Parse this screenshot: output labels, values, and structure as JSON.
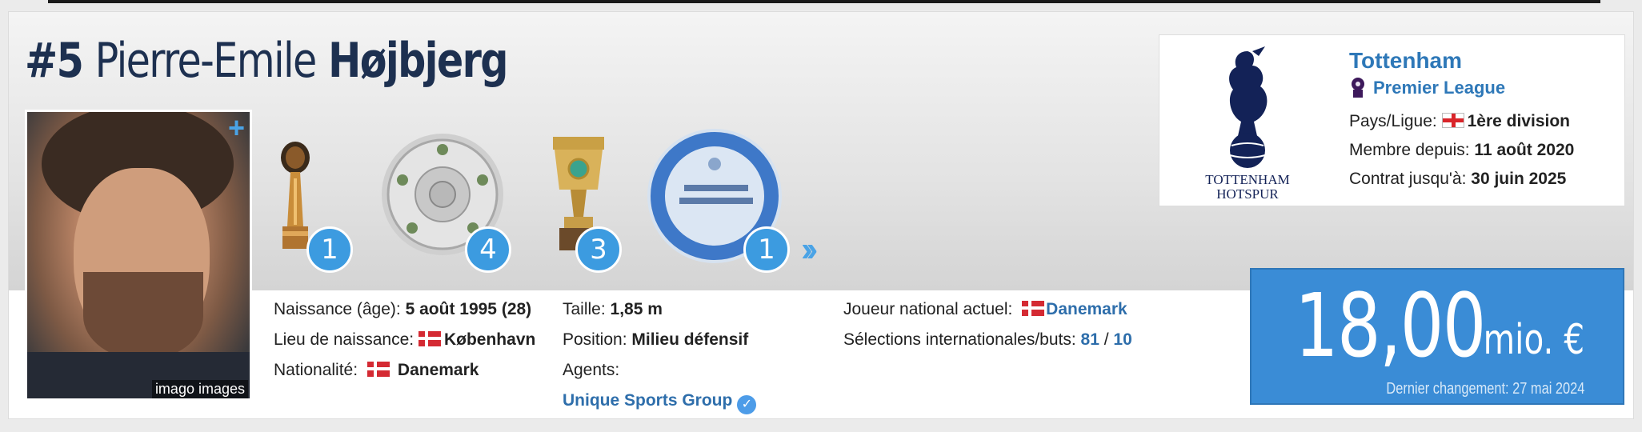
{
  "player": {
    "number": "#5",
    "first_name": "Pierre-Emile",
    "last_name": "Højbjerg",
    "photo_credit": "imago images"
  },
  "trophies": [
    {
      "name": "club-world-cup",
      "count": "1"
    },
    {
      "name": "bundesliga-meisterschale",
      "count": "4"
    },
    {
      "name": "dfb-pokal",
      "count": "3"
    },
    {
      "name": "bayerischer-amateurmeister",
      "count": "1"
    }
  ],
  "club": {
    "name": "Tottenham",
    "league": "Premier League",
    "country_league_label": "Pays/Ligue:",
    "country_league_value": "1ère division",
    "member_since_label": "Membre depuis:",
    "member_since_value": "11 août 2020",
    "contract_label": "Contrat jusqu'à:",
    "contract_value": "30 juin 2025",
    "crest_text_1": "TOTTENHAM",
    "crest_text_2": "HOTSPUR"
  },
  "info": {
    "birth_label": "Naissance (âge):",
    "birth_value": "5 août 1995 (28)",
    "birthplace_label": "Lieu de naissance:",
    "birthplace_value": "København",
    "nationality_label": "Nationalité:",
    "nationality_value": "Danemark",
    "height_label": "Taille:",
    "height_value": "1,85 m",
    "position_label": "Position:",
    "position_value": "Milieu défensif",
    "agents_label": "Agents:",
    "agents_value": "Unique Sports Group",
    "national_label": "Joueur national actuel:",
    "national_value": "Danemark",
    "caps_label": "Sélections internationales/buts:",
    "caps_value": "81",
    "caps_sep": "/",
    "goals_value": "10"
  },
  "market_value": {
    "amount": "18,00",
    "unit": "mio. €",
    "last_change": "Dernier changement: 27 mai 2024"
  }
}
